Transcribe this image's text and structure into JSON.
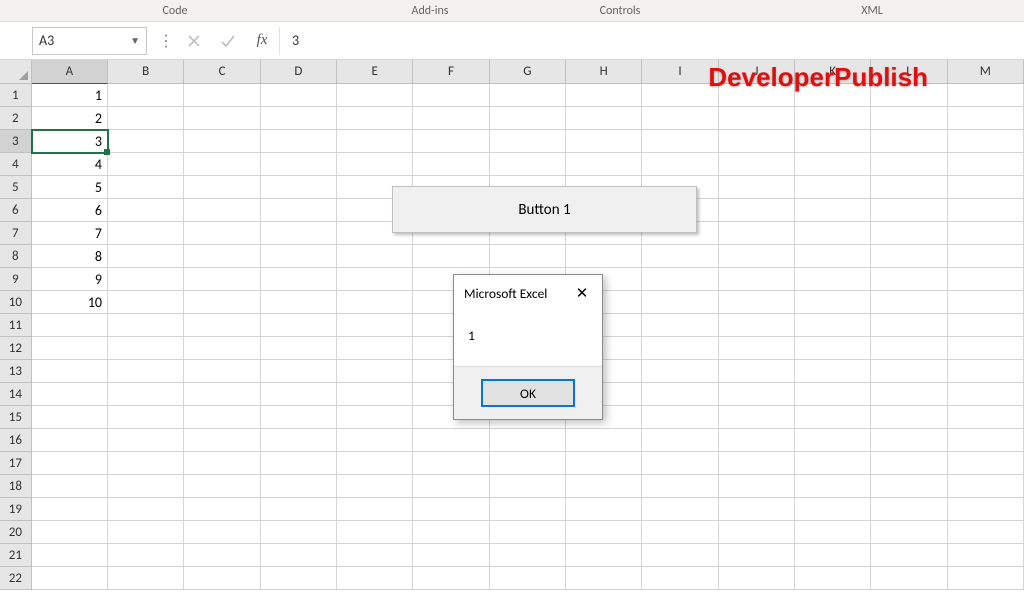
{
  "ribbon": {
    "groups": {
      "code": "Code",
      "addins": "Add-ins",
      "controls": "Controls",
      "xml": "XML"
    }
  },
  "namebox": {
    "value": "A3"
  },
  "formula": {
    "value": "3"
  },
  "columns": [
    "A",
    "B",
    "C",
    "D",
    "E",
    "F",
    "G",
    "H",
    "I",
    "J",
    "K",
    "L",
    "M"
  ],
  "active_col_index": 0,
  "rows": [
    1,
    2,
    3,
    4,
    5,
    6,
    7,
    8,
    9,
    10,
    11,
    12,
    13,
    14,
    15,
    16,
    17,
    18,
    19,
    20,
    21,
    22
  ],
  "active_row_index": 2,
  "cell_values": {
    "A1": "1",
    "A2": "2",
    "A3": "3",
    "A4": "4",
    "A5": "5",
    "A6": "6",
    "A7": "7",
    "A8": "8",
    "A9": "9",
    "A10": "10"
  },
  "form_button": {
    "label": "Button 1"
  },
  "msgbox": {
    "title": "Microsoft Excel",
    "body": "1",
    "ok": "OK"
  },
  "watermark": "DeveloperPublish"
}
